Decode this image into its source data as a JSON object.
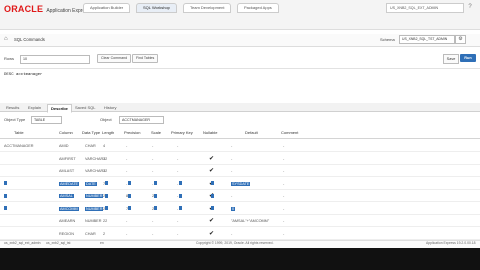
{
  "header": {
    "logo_brand": "ORACLE",
    "logo_product": "Application Express",
    "tabs": [
      {
        "label": "Application Builder"
      },
      {
        "label": "SQL Workshop"
      },
      {
        "label": "Team Development"
      },
      {
        "label": "Packaged Apps"
      }
    ],
    "active_tab_index": 1,
    "user_menu": "US_XNB2_SQL_EXT_ADMIN",
    "help_icon": "help-icon"
  },
  "breadcrumb": {
    "title": "SQL Commands",
    "schema_label": "Schema",
    "schema_value": "US_XNB2_SQL_TST_ADMIN"
  },
  "toolbar": {
    "rows_label": "Rows",
    "rows_value": "10",
    "clear_label": "Clear Command",
    "find_label": "Find Tables",
    "save_label": "Save",
    "run_label": "Run"
  },
  "editor": {
    "text": "DESC acctmanager"
  },
  "results": {
    "tabs": [
      "Results",
      "Explain",
      "Describe",
      "Saved SQL",
      "History"
    ],
    "active_index": 2,
    "object_type_label": "Object Type",
    "object_type_value": "TABLE",
    "object_label": "Object",
    "object_value": "ACCTMANAGER"
  },
  "grid": {
    "headers": [
      "Table",
      "Column",
      "Data Type",
      "Length",
      "Precision",
      "Scale",
      "Primary Key",
      "Nullable",
      "Default",
      "Comment"
    ],
    "rows": [
      {
        "table": "ACCTMANAGER",
        "column": "AMID",
        "type": "CHAR",
        "length": "4",
        "precision": "-",
        "scale": "-",
        "pk": "-",
        "nullable": "",
        "default": "-",
        "comment": "-"
      },
      {
        "table": "",
        "column": "AMFIRST",
        "type": "VARCHAR2",
        "length": "12",
        "precision": "-",
        "scale": "-",
        "pk": "-",
        "nullable": "✔",
        "default": "-",
        "comment": "-"
      },
      {
        "table": "",
        "column": "AMLAST",
        "type": "VARCHAR2",
        "length": "12",
        "precision": "-",
        "scale": "-",
        "pk": "-",
        "nullable": "✔",
        "default": "-",
        "comment": "-"
      },
      {
        "table": "",
        "column": "AMEDATE",
        "type": "DATE",
        "length": "7",
        "precision": "-",
        "scale": "-",
        "pk": "-",
        "nullable": "✔",
        "default": "SYSDATE",
        "comment": "-"
      },
      {
        "table": "",
        "column": "AMSAL",
        "type": "NUMBER",
        "length": "22",
        "precision": "8",
        "scale": "2",
        "pk": "-",
        "nullable": "✔",
        "default": "-",
        "comment": "-"
      },
      {
        "table": "",
        "column": "AMCOMM",
        "type": "NUMBER",
        "length": "22",
        "precision": "7",
        "scale": "2",
        "pk": "-",
        "nullable": "✔",
        "default": "0",
        "comment": "-"
      },
      {
        "table": "",
        "column": "AMEARN",
        "type": "NUMBER",
        "length": "22",
        "precision": "-",
        "scale": "-",
        "pk": "-",
        "nullable": "✔",
        "default": "\"AMSAL\"+\"AMCOMM\"",
        "comment": "-"
      },
      {
        "table": "",
        "column": "REGION",
        "type": "CHAR",
        "length": "2",
        "precision": "-",
        "scale": "-",
        "pk": "-",
        "nullable": "✔",
        "default": "-",
        "comment": "-"
      }
    ],
    "page_marker": "1 - 8"
  },
  "status": {
    "user": "us_xnb2_sql_ext_admin",
    "schema": "us_xnb2_sql_tst",
    "language": "en",
    "copyright": "Copyright © 1999, 2019, Oracle. All rights reserved.",
    "version": "Application Express 19.2.0.00.18"
  }
}
